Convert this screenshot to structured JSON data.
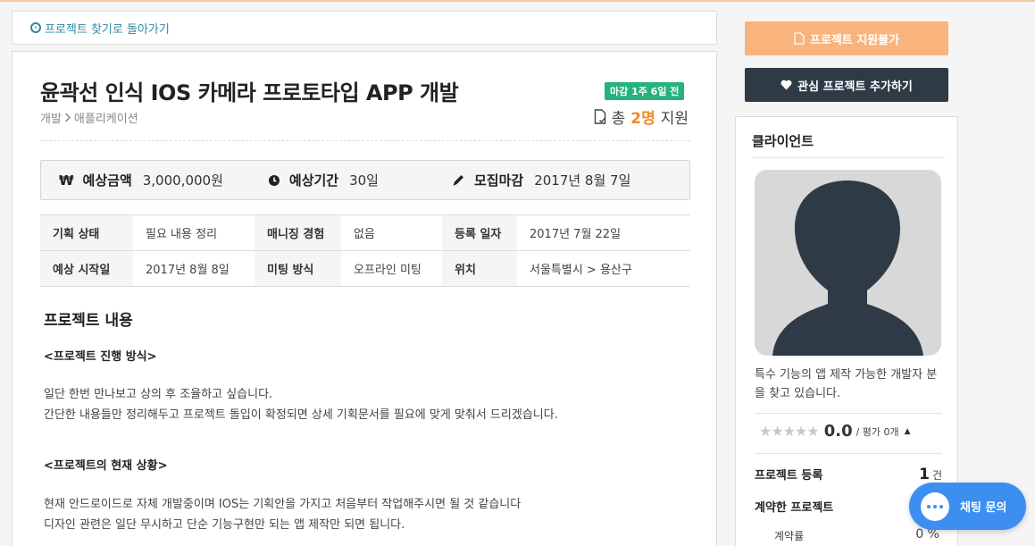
{
  "nav": {
    "back_label": "프로젝트 찾기로 돌아가기"
  },
  "project": {
    "title": "윤곽선 인식 IOS 카메라 프로토타입 APP 개발",
    "deadline_badge": "마감 1주 6일 전",
    "category": [
      "개발",
      "애플리케이션"
    ],
    "applicants_prefix": "총",
    "applicants_count": "2명",
    "applicants_suffix": "지원"
  },
  "summary": {
    "budget_label": "예상금액",
    "budget_value": "3,000,000원",
    "period_label": "예상기간",
    "period_value": "30일",
    "deadline_label": "모집마감",
    "deadline_value": "2017년 8월 7일"
  },
  "info": [
    [
      {
        "h": "기획 상태"
      },
      {
        "v": "필요 내용 정리"
      },
      {
        "h": "매니징 경험"
      },
      {
        "v": "없음"
      },
      {
        "h": "등록 일자"
      },
      {
        "v": "2017년 7월 22일"
      }
    ],
    [
      {
        "h": "예상 시작일"
      },
      {
        "v": "2017년 8월 8일"
      },
      {
        "h": "미팅 방식"
      },
      {
        "v": "오프라인 미팅"
      },
      {
        "h": "위치"
      },
      {
        "v": "서울특별시 > 용산구"
      }
    ]
  ],
  "content": {
    "title": "프로젝트 내용",
    "sub1": "<프로젝트 진행 방식>",
    "p1_line1": "일단 한번 만나보고 상의 후 조율하고 싶습니다.",
    "p1_line2": "간단한 내용들만 정리해두고 프로젝트 돌입이 확정되면 상세 기획문서를 필요에 맞게 맞춰서 드리겠습니다.",
    "sub2": "<프로젝트의 현재 상황>",
    "p2_line1": "현재 안드로이드로 자체 개발중이며 IOS는 기획안을 가지고 처음부터 작업해주시면 될 것 같습니다",
    "p2_line2": "디자인 관련은 일단 무시하고 단순 기능구현만 되는 앱 제작만 되면 됩니다."
  },
  "sidebar": {
    "apply_label": "프로젝트 지원불가",
    "interest_label": "관심 프로젝트 추가하기",
    "client_title": "클라이언트",
    "client_desc": "특수 기능의 앱 제작 가능한 개발자 분을 찾고 있습니다.",
    "rating_stars": 0,
    "rating_score": "0.0",
    "rating_sub": "/ 평가 0개",
    "stat_registered_label": "프로젝트 등록",
    "stat_registered_value": "1",
    "stat_registered_unit": "건",
    "stat_contracted_label": "계약한 프로젝트",
    "stat_contract_rate_label": "계약률",
    "stat_contract_rate_value": "0 %"
  },
  "chat": {
    "label": "채팅 문의"
  },
  "colors": {
    "accent": "#f08a24",
    "badge": "#26b27b",
    "dark_button": "#2e3b47",
    "apply_button": "#f8b47c",
    "chat": "#3c8ff0",
    "link": "#2b89a6"
  }
}
